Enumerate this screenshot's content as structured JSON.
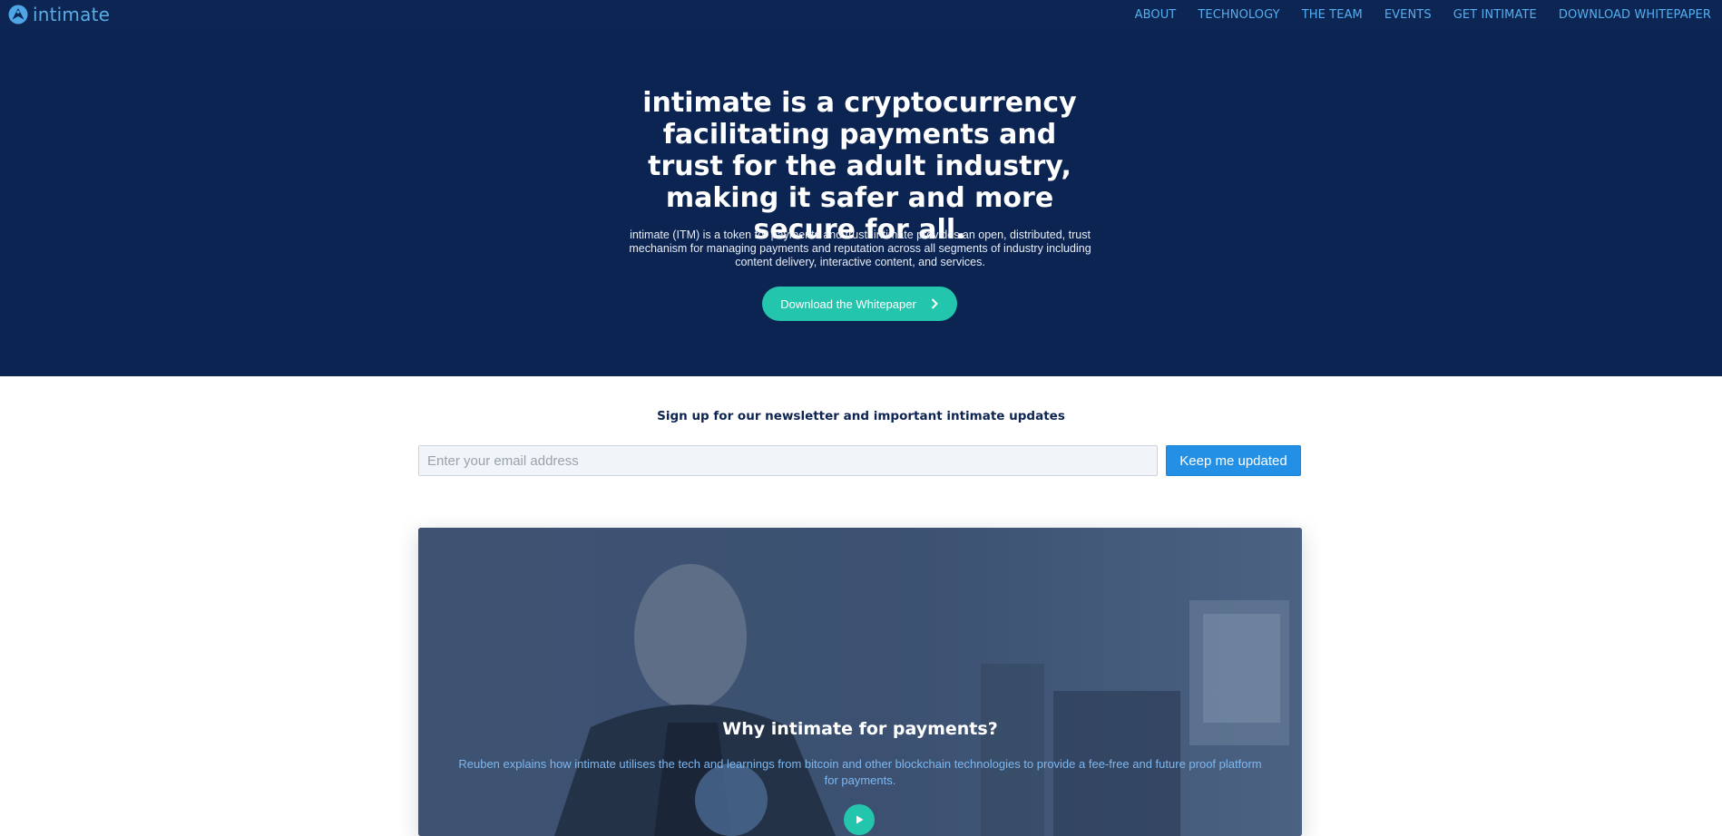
{
  "nav": {
    "brand": "intimate",
    "links": [
      "ABOUT",
      "TECHNOLOGY",
      "THE TEAM",
      "EVENTS",
      "GET INTIMATE",
      "DOWNLOAD WHITEPAPER"
    ]
  },
  "hero": {
    "title": "intimate is a cryptocurrency facilitating payments and trust for the adult industry, making it safer and more secure for all.",
    "description": "intimate (ITM) is a token for payments and trust. intimate provides an open, distributed, trust mechanism for managing payments and reputation across all segments of industry including content delivery, interactive content, and services.",
    "button_label": "Download the Whitepaper"
  },
  "newsletter": {
    "title": "Sign up for our newsletter and important intimate updates",
    "email_placeholder": "Enter your email address",
    "email_value": "",
    "button_label": "Keep me updated"
  },
  "video": {
    "title": "Why intimate for payments?",
    "description": "Reuben explains how intimate utilises the tech and learnings from bitcoin and other blockchain technologies to provide a fee-free and future proof platform for payments."
  },
  "colors": {
    "nav_bg": "#0c2552",
    "hero_bg": "#0b2452",
    "accent_teal": "#23c6ad",
    "link_blue": "#56aef0",
    "cta_blue": "#2390e6"
  },
  "icons": {
    "brand": "intimate-logo-icon",
    "hero_button": "chevron-right-icon",
    "video_button": "play-icon"
  }
}
